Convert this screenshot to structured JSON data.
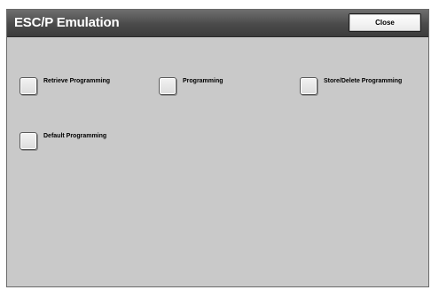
{
  "window": {
    "title": "ESC/P Emulation",
    "close_label": "Close"
  },
  "options": [
    {
      "label": "Retrieve Programming"
    },
    {
      "label": "Programming"
    },
    {
      "label": "Store/Delete Programming"
    },
    {
      "label": "Default Programming"
    }
  ]
}
